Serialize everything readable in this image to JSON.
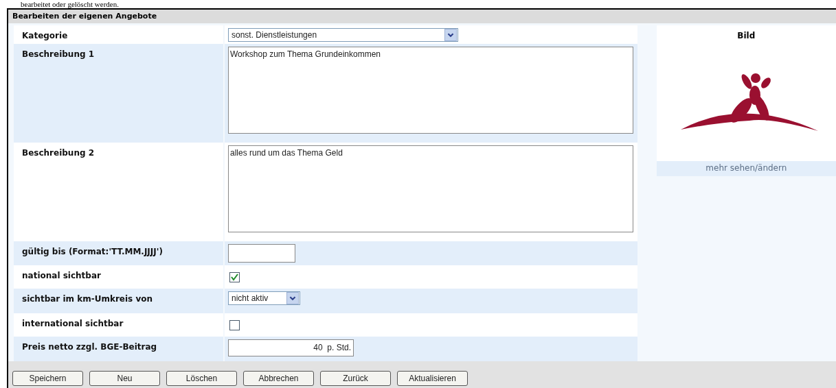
{
  "page_text_cut": "bearbeitet oder gelöscht werden.",
  "panel": {
    "title": "Bearbeiten der eigenen Angebote"
  },
  "fields": [
    {
      "kind": "select",
      "label": "Kategorie",
      "value": "sonst. Dienstleistungen"
    },
    {
      "kind": "textarea",
      "label": "Beschreibung 1",
      "value": "Workshop zum Thema Grundeinkommen"
    },
    {
      "kind": "textarea",
      "label": "Beschreibung 2",
      "value": "alles rund um das Thema Geld"
    },
    {
      "kind": "text",
      "label": "gültig bis (Format:'TT.MM.JJJJ')"
    },
    {
      "kind": "checkbox",
      "label": "national sichtbar",
      "checked": true
    },
    {
      "kind": "smallselect",
      "label": "sichtbar im km-Umkreis von",
      "value": "nicht aktiv"
    },
    {
      "kind": "checkbox",
      "label": "international sichtbar",
      "checked": false
    },
    {
      "kind": "price",
      "label": "Preis netto zzgl. BGE-Beitrag",
      "value": "40  p. Std."
    }
  ],
  "image_panel": {
    "title": "Bild",
    "link": "mehr sehen/ändern"
  },
  "buttons": [
    "Speichern",
    "Neu",
    "Löschen",
    "Abbrechen",
    "Zurück",
    "Aktualisieren"
  ]
}
